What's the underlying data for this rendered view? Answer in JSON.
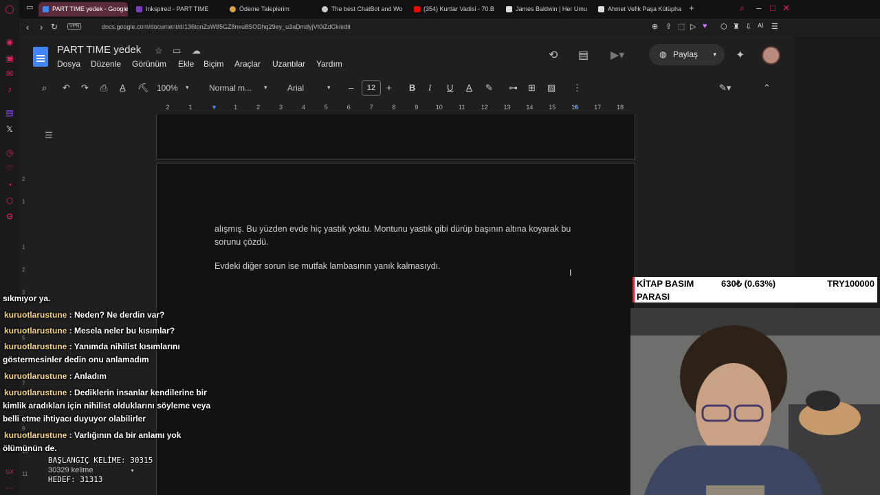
{
  "browser": {
    "tabs": [
      {
        "label": "PART TIME yedek - Google",
        "active": true,
        "color": "#4285f4"
      },
      {
        "label": "Inkspired - PART TIME",
        "color": "#7b3fb5"
      },
      {
        "label": "Ödeme Taleplerim",
        "color": "#d9a441"
      },
      {
        "label": "The best ChatBot and Wo",
        "color": "#cccccc"
      },
      {
        "label": "(354) Kurtlar Vadisi - 70.B",
        "color": "#ff0000"
      },
      {
        "label": "James Baldwin | Her Umu",
        "color": "#dddddd"
      },
      {
        "label": "Ahmet Vefik Paşa Kütüpha",
        "color": "#dddddd"
      }
    ],
    "vpn_label": "VPN",
    "url": "docs.google.com/document/d/136tonZsW85GZ8nxu8SODhq29ey_u3aDmdyjVt0iZdCk/edit",
    "ai_label": "AI"
  },
  "docs": {
    "title": "PART TIME  yedek",
    "menu": [
      "Dosya",
      "Düzenle",
      "Görünüm",
      "Ekle",
      "Biçim",
      "Araçlar",
      "Uzantılar",
      "Yardım"
    ],
    "share_label": "Paylaş",
    "toolbar": {
      "zoom": "100%",
      "style": "Normal m...",
      "font": "Arial",
      "font_size": "12"
    },
    "ruler_ticks": [
      "2",
      "1",
      "",
      "1",
      "2",
      "3",
      "4",
      "5",
      "6",
      "7",
      "8",
      "9",
      "10",
      "11",
      "12",
      "13",
      "14",
      "15",
      "16",
      "17",
      "18"
    ],
    "vruler_ticks": [
      "2",
      "1",
      "",
      "1",
      "2",
      "3",
      "4",
      "5",
      "6",
      "7",
      "8",
      "9",
      "10",
      "11"
    ],
    "paragraphs": [
      "alışmış. Bu yüzden evde hiç yastık yoktu. Montunu yastık gibi dürüp başının altına koyarak bu sorunu çözdü.",
      "Evdeki diğer sorun ise mutfak lambasının yanık kalmasıydı."
    ],
    "word_count_chip": "30329 kelime"
  },
  "stream": {
    "chat": [
      {
        "user": "",
        "text": "sıkmıyor ya."
      },
      {
        "user": "kuruotlarustune",
        "text": " : Neden? Ne derdin var?"
      },
      {
        "user": "kuruotlarustune",
        "text": " : Mesela neler bu kısımlar?"
      },
      {
        "user": "kuruotlarustune",
        "text": " : Yanımda nihilist kısımlarını göstermesinler dedin onu anlamadım"
      },
      {
        "user": "kuruotlarustune",
        "text": " : Anladım"
      },
      {
        "user": "kuruotlarustune",
        "text": " : Dediklerin insanlar kendilerine bir kimlik aradıkları için nihilist olduklarını söyleme veya belli etme ihtiyacı duyuyor olabilirler"
      },
      {
        "user": "kuruotlarustune",
        "text": " : Varlığının da bir anlamı yok ölümünün de."
      }
    ],
    "counter": {
      "start_label": "BAŞLANGIÇ KELİME: 30315",
      "target_label": "HEDEF: 31313"
    },
    "book_goal": {
      "title_line1": "KİTAP BASIM",
      "title_line2": "PARASI",
      "progress": "630₺ (0.63%)",
      "target": "TRY100000",
      "progress_fraction": 0.0063,
      "accent": "#d6263b"
    }
  }
}
